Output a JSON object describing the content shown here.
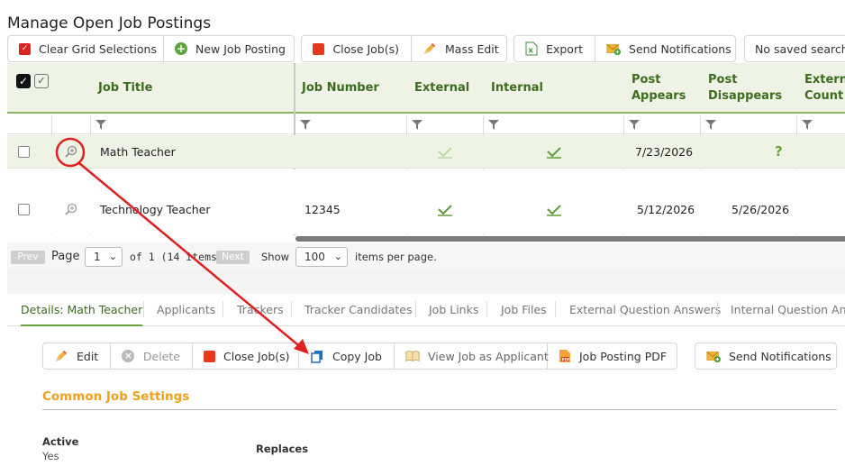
{
  "page": {
    "title": "Manage Open Job Postings"
  },
  "toolbar": {
    "clear_grid": "Clear Grid Selections",
    "new_job": "New Job Posting",
    "close_jobs": "Close Job(s)",
    "mass_edit": "Mass Edit",
    "export": "Export",
    "send_notifications": "Send Notifications",
    "saved_searches": "No saved searches"
  },
  "grid": {
    "headers": {
      "job_title": "Job Title",
      "job_number": "Job Number",
      "external": "External",
      "internal": "Internal",
      "post_appears_1": "Post",
      "post_appears_2": "Appears",
      "post_disappears_1": "Post",
      "post_disappears_2": "Disappears",
      "external_count_1": "External",
      "external_count_2": "Count"
    },
    "rows": [
      {
        "title": "Math Teacher",
        "job_number": "",
        "external": true,
        "internal": true,
        "post_appears": "7/23/2026",
        "post_disappears": "?"
      },
      {
        "title": "Technology Teacher",
        "job_number": "12345",
        "external": true,
        "internal": true,
        "post_appears": "5/12/2026",
        "post_disappears": "5/26/2026"
      }
    ]
  },
  "pager": {
    "prev": "Prev",
    "page_label": "Page",
    "page_value": "1",
    "of_text": "of 1 (14 items)",
    "next": "Next",
    "show_label": "Show",
    "per_page_value": "100",
    "per_page_suffix": "items per page."
  },
  "details": {
    "tabs": [
      "Details: Math Teacher",
      "Applicants",
      "Trackers",
      "Tracker Candidates",
      "Job Links",
      "Job Files",
      "External Question Answers",
      "Internal Question Answers"
    ],
    "actions": {
      "edit": "Edit",
      "delete": "Delete",
      "close_jobs": "Close Job(s)",
      "copy_job": "Copy Job",
      "view_as_applicant": "View Job as Applicant",
      "pdf": "Job Posting PDF",
      "send_notifications": "Send Notifications"
    },
    "section_title": "Common Job Settings",
    "fields": {
      "active_label": "Active",
      "active_value": "Yes",
      "replaces_label": "Replaces"
    }
  },
  "colors": {
    "accent_green": "#3d6c1e",
    "header_bg": "#eef3e6",
    "annotation_red": "#e02020",
    "section_orange": "#f0a01c"
  },
  "icons": [
    "checkbox-red-icon",
    "plus-circle-icon",
    "red-square-icon",
    "pencil-icon",
    "excel-icon",
    "envelope-plus-icon",
    "funnel-icon",
    "zoom-icon",
    "checkmark-icon",
    "question-icon",
    "copy-icon",
    "book-icon",
    "pdf-icon",
    "delete-circle-icon"
  ]
}
